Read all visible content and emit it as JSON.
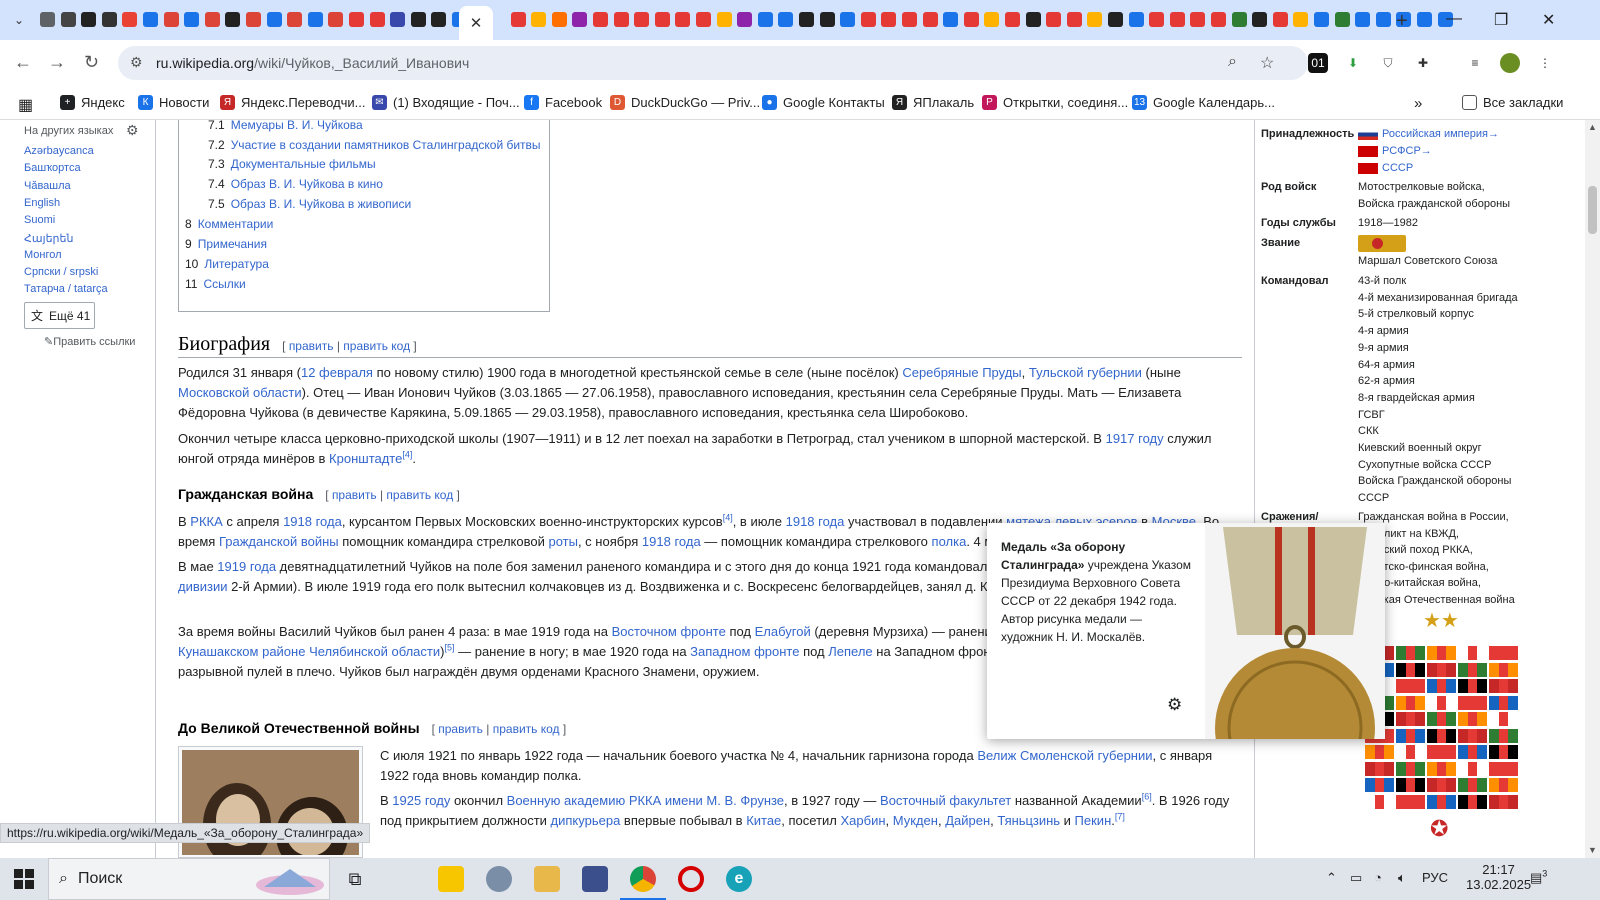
{
  "browser": {
    "url_host": "ru.wikipedia.org",
    "url_path": "/wiki/Чуйков,_Василий_Иванович",
    "tab_colors": [
      "#5f6368",
      "#444",
      "#222",
      "#333",
      "#e94235",
      "#1a73e8",
      "#db4437",
      "#1a73e8",
      "#db4437",
      "#222",
      "#db4437",
      "#1a73e8",
      "#db4437",
      "#1a73e8",
      "#db4437",
      "#e53935",
      "#e53935",
      "#3949ab",
      "#222",
      "#222",
      "#1a73e8",
      "#e53935",
      "#ffb300",
      "#ff6f00",
      "#8e24aa",
      "#e53935",
      "#e53935",
      "#e53935",
      "#e53935",
      "#e53935",
      "#e53935",
      "#ffb300",
      "#8e24aa",
      "#1a73e8",
      "#1a73e8",
      "#222",
      "#222",
      "#1a73e8",
      "#e53935",
      "#e53935",
      "#e53935",
      "#e53935",
      "#1a73e8",
      "#e53935",
      "#ffb300",
      "#e53935",
      "#222",
      "#e53935",
      "#e53935",
      "#ffb300",
      "#222",
      "#1a73e8",
      "#e53935",
      "#e53935",
      "#e53935",
      "#e53935",
      "#2e7d32",
      "#222",
      "#e53935",
      "#ffb300",
      "#1a73e8",
      "#2e7d32",
      "#1a73e8",
      "#1a73e8",
      "#1a73e8",
      "#1a73e8",
      "#1a73e8"
    ],
    "active_tab_close": "✕",
    "new_tab": "+",
    "bookmarks": [
      {
        "label": "Яндекс",
        "color": "#202124",
        "glyph": "+"
      },
      {
        "label": "Новости",
        "color": "#1a73e8",
        "glyph": "К"
      },
      {
        "label": "Яндекс.Переводчи...",
        "color": "#c62828",
        "glyph": "Я"
      },
      {
        "label": "(1) Входящие - Поч...",
        "color": "#3949ab",
        "glyph": "✉"
      },
      {
        "label": "Facebook",
        "color": "#1877f2",
        "glyph": "f"
      },
      {
        "label": "DuckDuckGo — Priv...",
        "color": "#de5833",
        "glyph": "D"
      },
      {
        "label": "Google Контакты",
        "color": "#1a73e8",
        "glyph": "●"
      },
      {
        "label": "ЯПлакаль",
        "color": "#222",
        "glyph": "Я"
      },
      {
        "label": "Открытки, соединя...",
        "color": "#c2185b",
        "glyph": "P"
      },
      {
        "label": "Google Календарь...",
        "color": "#1a73e8",
        "glyph": "13"
      }
    ],
    "all_bookmarks": "Все закладки"
  },
  "sidebar": {
    "header": "На других языках",
    "langs": [
      "Azərbaycanca",
      "Башҡортса",
      "Чӑвашла",
      "English",
      "Suomi",
      "Հայերեն",
      "Монгол",
      "Српски / srpski",
      "Татарча / tatarça"
    ],
    "more": "Ещё 41",
    "edit_links": "Править ссылки"
  },
  "toc": [
    {
      "n": "7.1",
      "t": "Мемуары В. И. Чуйкова",
      "indent": true
    },
    {
      "n": "7.2",
      "t": "Участие в создании памятников Сталинградской битвы",
      "indent": true
    },
    {
      "n": "7.3",
      "t": "Документальные фильмы",
      "indent": true
    },
    {
      "n": "7.4",
      "t": "Образ В. И. Чуйкова в кино",
      "indent": true
    },
    {
      "n": "7.5",
      "t": "Образ В. И. Чуйкова в живописи",
      "indent": true
    },
    {
      "n": "8",
      "t": "Комментарии",
      "indent": false
    },
    {
      "n": "9",
      "t": "Примечания",
      "indent": false
    },
    {
      "n": "10",
      "t": "Литература",
      "indent": false
    },
    {
      "n": "11",
      "t": "Ссылки",
      "indent": false
    }
  ],
  "article": {
    "edit": "править",
    "edit_code": "править код",
    "bio_title": "Биография",
    "p1": "Родился 31 января (<a>12 февраля</a> по новому стилю) 1900 года в многодетной крестьянской семье в селе (ныне посёлок) <a>Серебряные Пруды</a>, <a>Тульской губернии</a> (ныне <a>Московской области</a>). Отец — Иван Ионович Чуйков (3.03.1865 — 27.06.1958), православного исповедания, крестьянин села Серебряные Пруды. Мать — Елизавета Фёдоровна Чуйкова (в девичестве Карякина, 5.09.1865 — 29.03.1958), православного исповедания, крестьянка села Широбоково.",
    "p2": "Окончил четыре класса церковно-приходской школы (1907—1911) и в 12 лет поехал на заработки в Петроград, стал учеником в шпорной мастерской. В <a>1917 году</a> служил юнгой отряда минёров в <a>Кронштадте</a><sup><a>[4]</a></sup>.",
    "civil_title": "Гражданская война",
    "p3": "В <a>РККА</a> с апреля <a>1918 года</a>, курсантом Первых Московских военно-инструкторских курсов<sup><a>[4]</a></sup>, в июле <a>1918 года</a> участвовал в подавлении <a>мятежа левых эсеров</a> в <a>Москве</a>. Во время <a>Гражданской войны</a> помощник командира стрелковой <a>роты</a>, с ноября <a>1918 года</a> — помощник командира стрелкового <a>полка</a>. 4 мая 1919 года",
    "p4": "В мае <a>1919 года</a> девятнадцатилетний Чуйков на поле боя заменил раненого командира и с этого дня до конца 1921 года командовал 43-м п года — 40-й полк <a>28-й стрелковой дивизии</a> 2-й Армии). В июле 1919 года его полк вытеснил колчаковцев из д. Воздвиженка и с. Воскресенс белогвардейцев, занял д. Караболку и Куяш.",
    "p5": "За время войны Василий Чуйков был ранен 4 раза: в мае 1919 года на <a>Восточном фронте</a> под <a>Елабугой</a> (деревня Мурзиха) — ранение в ру села <a>Муслюмово</a> (ныне в <a>Кунашакском районе</a> <a>Челябинской области</a>)<sup><a>[5]</a></sup> — ранение в ногу; в мае 1920 года на <a>Западном фронте</a> под <a>Лепеле</a> на Западном фронте под городом <a>Остров</a> — ранение разрывной пулей в плечо. Чуйков был награждён двумя орденами Красного Знамени, оружием.",
    "prewar_title": "До Великой Отечественной войны",
    "p6": "С июля 1921 по январь 1922 года — начальник боевого участка № 4, начальник гарнизона города <a>Велиж</a> <a>Смоленской губернии</a>, с января 1922 года вновь командир полка.",
    "p7": "В <a>1925 году</a> окончил <a>Военную академию РККА имени М. В. Фрунзе</a>, в 1927 году — <a>Восточный факультет</a> названной Академии<sup><a>[6]</a></sup>. В 1926 году под прикрытием должности <a>дипкурьера</a> впервые побывал в <a>Китае</a>, посетил <a>Харбин</a>, <a>Мукден</a>, <a>Дайрен</a>, <a>Тяньцзинь</a> и <a>Пекин</a>.<sup><a>[7]</a></sup>"
  },
  "infobox": {
    "allegiance_k": "Принадлежность",
    "allegiance": [
      {
        "t": "Российская империя→",
        "flag": "ru"
      },
      {
        "t": "РСФСР→",
        "flag": "su"
      },
      {
        "t": "СССР",
        "flag": "su"
      }
    ],
    "branch_k": "Род войск",
    "branch": [
      "Мотострелковые войска,",
      "Войска гражданской обороны"
    ],
    "years_k": "Годы службы",
    "years": "1918—1982",
    "rank_k": "Звание",
    "rank": "Маршал Советского Союза",
    "cmd_k": "Командовал",
    "cmd": [
      {
        "t": "43-й полк",
        "l": false
      },
      {
        "t": "4-й механизированная бригада",
        "l": false
      },
      {
        "t": "5-й стрелковый корпус",
        "l": true
      },
      {
        "t": "4-я армия",
        "l": true
      },
      {
        "t": "9-я армия",
        "l": true
      },
      {
        "t": "64-я армия",
        "l": true
      },
      {
        "t": "62-я армия",
        "l": true
      },
      {
        "t": "8-я гвардейская армия",
        "l": true
      },
      {
        "t": "ГСВГ",
        "l": true
      },
      {
        "t": "СКК",
        "l": true
      },
      {
        "t": "Киевский военный округ",
        "l": true
      },
      {
        "t": "Сухопутные войска СССР",
        "l": true
      },
      {
        "t": "Войска Гражданской обороны",
        "l": true
      },
      {
        "t": "СССР",
        "l": true
      }
    ],
    "battles_k": "Сражения/",
    "battles": [
      "Гражданская война в России,",
      "конфликт на КВЖД,",
      "Польский поход РККА,",
      "Советско-финская война,",
      "Японо-китайская война,",
      "Великая Отечественная война"
    ]
  },
  "popup": {
    "title": "Медаль «За оборону Сталинграда»",
    "text": " учреждена Указом Президиума Верховного Совета СССР от 22 декабря 1942 года. Автор рисунка медали — художник Н. И. Москалёв."
  },
  "status_url": "https://ru.wikipedia.org/wiki/Медаль_«За_оборону_Сталинграда»",
  "taskbar": {
    "search": "Поиск",
    "lang": "РУС",
    "time": "21:17",
    "date": "13.02.2025",
    "notif": "3"
  }
}
